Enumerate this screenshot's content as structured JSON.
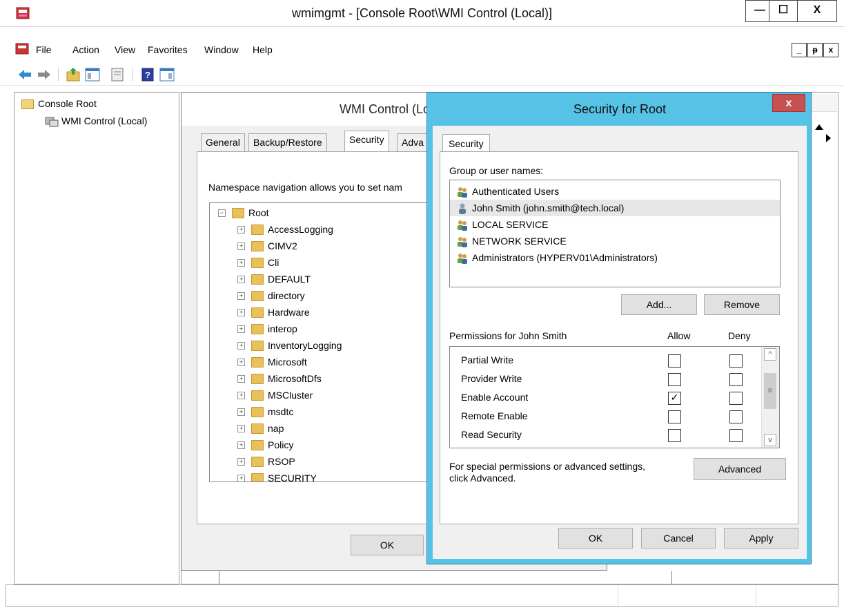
{
  "window": {
    "title": "wmimgmt - [Console Root\\WMI Control (Local)]",
    "minimize": "—",
    "maximize": "☐",
    "close": "X"
  },
  "menu": {
    "items": [
      "File",
      "Action",
      "View",
      "Favorites",
      "Window",
      "Help"
    ],
    "mdi_min": "_",
    "mdi_restore": "ᵽ",
    "mdi_close": "x"
  },
  "toolbar": {
    "icons": [
      "back-arrow-icon",
      "forward-arrow-icon",
      "up-folder-icon",
      "show-hide-tree-icon",
      "properties-icon",
      "help-icon",
      "show-action-pane-icon"
    ]
  },
  "tree": {
    "root": "Console Root",
    "child": "WMI Control (Local)"
  },
  "prop_dialog": {
    "title": "WMI Control (Local)",
    "tabs": [
      "General",
      "Backup/Restore",
      "Security",
      "Adva"
    ],
    "active_tab": "Security",
    "namespace_text": "Namespace navigation allows you to set nam",
    "namespace_root": "Root",
    "namespaces": [
      "AccessLogging",
      "CIMV2",
      "Cli",
      "DEFAULT",
      "directory",
      "Hardware",
      "interop",
      "InventoryLogging",
      "Microsoft",
      "MicrosoftDfs",
      "MSCluster",
      "msdtc",
      "nap",
      "Policy",
      "RSOP",
      "SECURITY"
    ],
    "ok": "OK"
  },
  "sec_dialog": {
    "title": "Security for Root",
    "close": "x",
    "tab": "Security",
    "group_label": "Group or user names:",
    "users": [
      {
        "name": "Authenticated Users",
        "type": "group",
        "selected": false
      },
      {
        "name": "John Smith (john.smith@tech.local)",
        "type": "user",
        "selected": true
      },
      {
        "name": "LOCAL SERVICE",
        "type": "group",
        "selected": false
      },
      {
        "name": "NETWORK SERVICE",
        "type": "group",
        "selected": false
      },
      {
        "name": "Administrators (HYPERV01\\Administrators)",
        "type": "group",
        "selected": false
      }
    ],
    "add": "Add...",
    "remove": "Remove",
    "perm_header": "Permissions for John Smith",
    "allow_header": "Allow",
    "deny_header": "Deny",
    "permissions": [
      {
        "name": "Partial Write",
        "allow": false,
        "deny": false
      },
      {
        "name": "Provider Write",
        "allow": false,
        "deny": false
      },
      {
        "name": "Enable Account",
        "allow": true,
        "deny": false
      },
      {
        "name": "Remote Enable",
        "allow": false,
        "deny": false
      },
      {
        "name": "Read Security",
        "allow": false,
        "deny": false
      }
    ],
    "special_text_line1": "For special permissions or advanced settings,",
    "special_text_line2": "click Advanced.",
    "advanced": "Advanced",
    "ok": "OK",
    "cancel": "Cancel",
    "apply": "Apply"
  },
  "colors": {
    "dialog_frame": "#56c2e6",
    "close_button": "#c75050",
    "folder": "#e8c15a"
  }
}
